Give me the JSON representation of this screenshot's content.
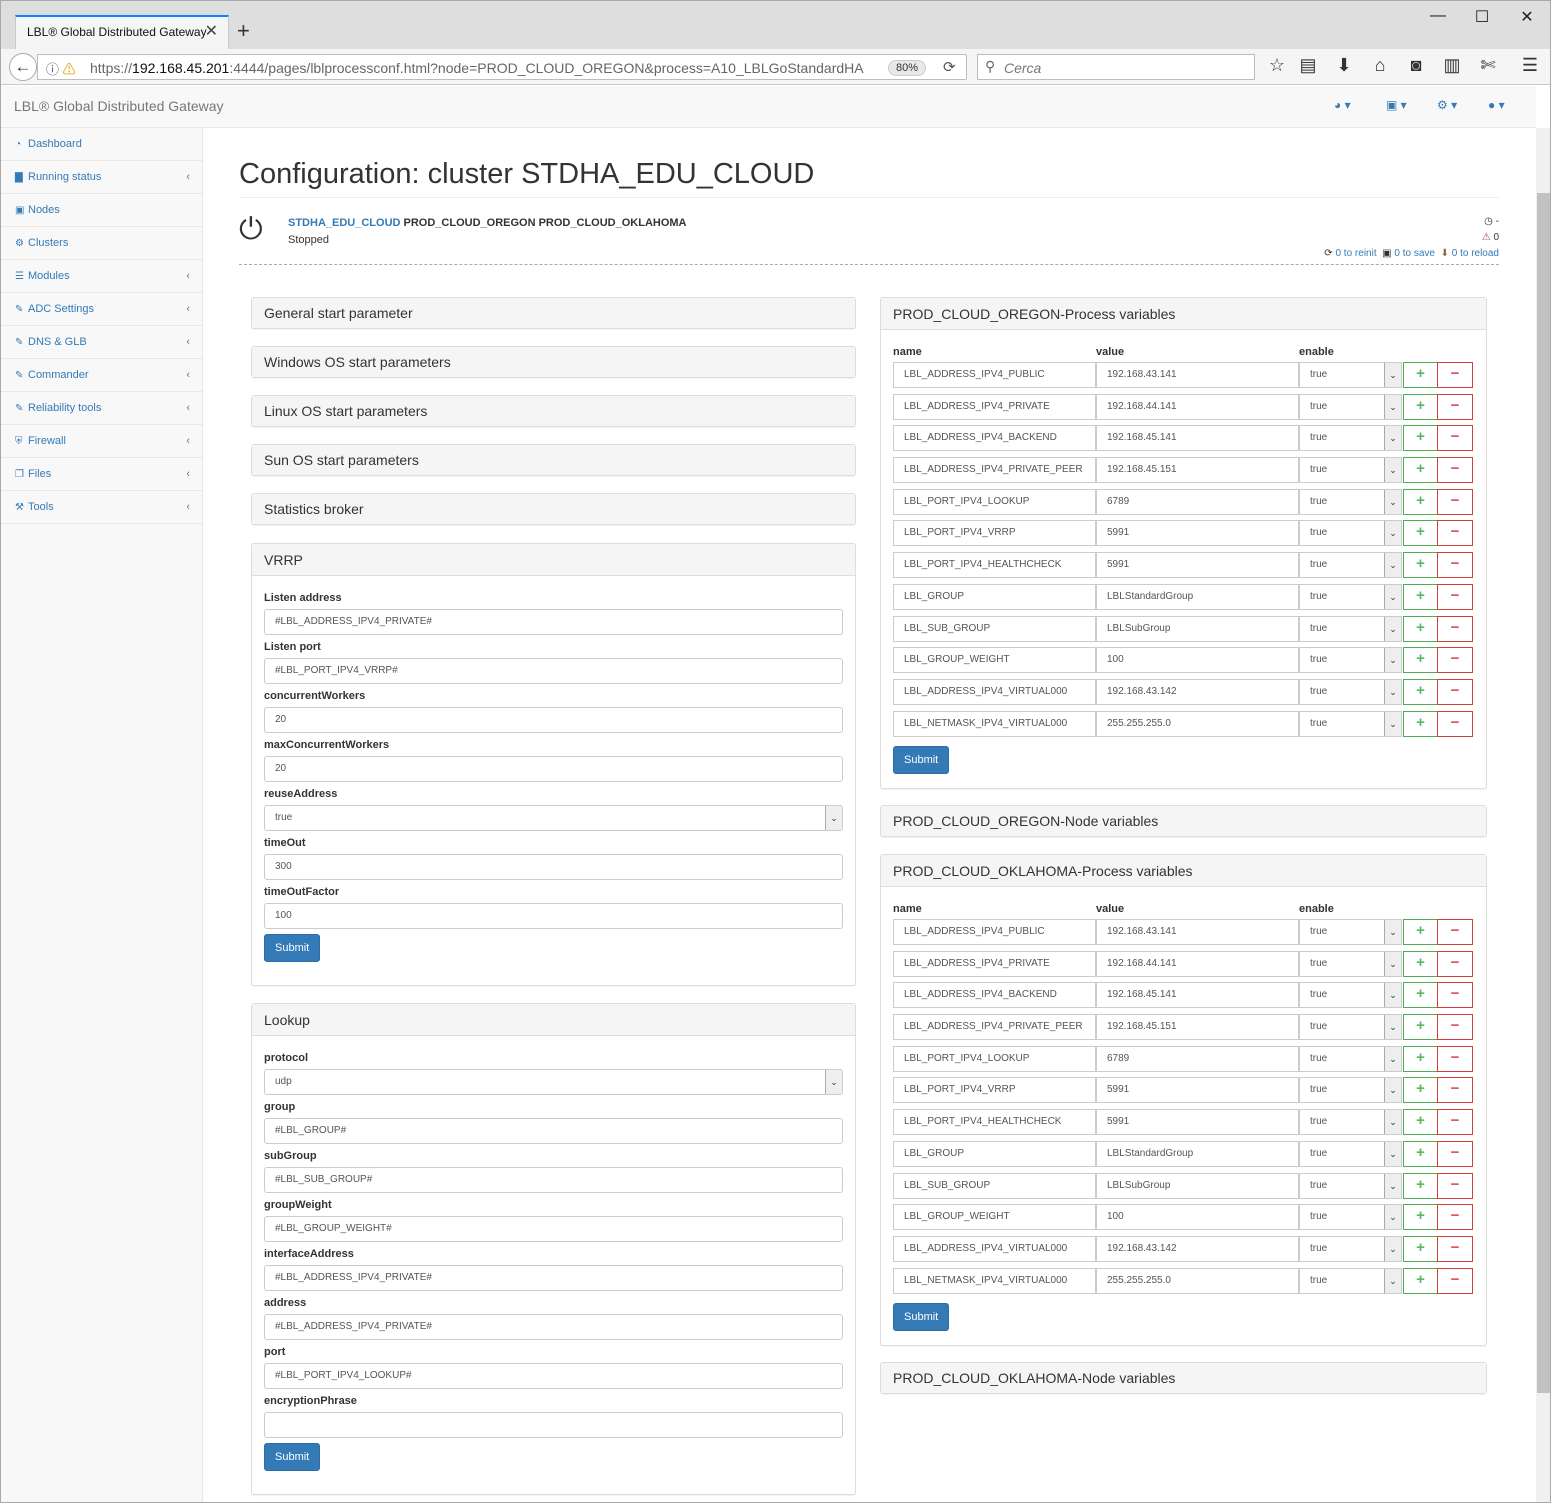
{
  "browser": {
    "tab_title": "LBL® Global Distributed Gateway",
    "url_prefix": "https://",
    "url_host": "192.168.45.201",
    "url_rest": ":4444/pages/lblprocessconf.html?node=PROD_CLOUD_OREGON&process=A10_LBLGoStandardHA",
    "zoom": "80%",
    "search_placeholder": "Cerca"
  },
  "app": {
    "brand": "LBL® Global Distributed Gateway"
  },
  "sidebar": {
    "items": [
      {
        "label": "Dashboard",
        "icon": "dashboard-icon",
        "glyph": "◔",
        "chevron": false
      },
      {
        "label": "Running status",
        "icon": "bar-chart-icon",
        "glyph": "▇",
        "chevron": true
      },
      {
        "label": "Nodes",
        "icon": "cube-icon",
        "glyph": "▣",
        "chevron": false
      },
      {
        "label": "Clusters",
        "icon": "cogs-icon",
        "glyph": "⚙",
        "chevron": false
      },
      {
        "label": "Modules",
        "icon": "list-icon",
        "glyph": "☰",
        "chevron": true
      },
      {
        "label": "ADC Settings",
        "icon": "edit-icon",
        "glyph": "✎",
        "chevron": true
      },
      {
        "label": "DNS & GLB",
        "icon": "edit-icon",
        "glyph": "✎",
        "chevron": true
      },
      {
        "label": "Commander",
        "icon": "edit-icon",
        "glyph": "✎",
        "chevron": true
      },
      {
        "label": "Reliability tools",
        "icon": "edit-icon",
        "glyph": "✎",
        "chevron": true
      },
      {
        "label": "Firewall",
        "icon": "shield-icon",
        "glyph": "⛨",
        "chevron": true
      },
      {
        "label": "Files",
        "icon": "files-icon",
        "glyph": "❐",
        "chevron": true
      },
      {
        "label": "Tools",
        "icon": "wrench-icon",
        "glyph": "⚒",
        "chevron": true
      }
    ]
  },
  "page": {
    "title": "Configuration: cluster STDHA_EDU_CLOUD",
    "cluster_link": "STDHA_EDU_CLOUD",
    "cluster_nodes": " PROD_CLOUD_OREGON PROD_CLOUD_OKLAHOMA",
    "status": "Stopped",
    "right_status_1": "-",
    "right_status_2": "0",
    "reinit": "0 to reinit",
    "save": "0 to save",
    "reload": "0 to reload"
  },
  "left_panels": {
    "general": "General start parameter",
    "windows": "Windows OS start parameters",
    "linux": "Linux OS start parameters",
    "sun": "Sun OS start parameters",
    "stats": "Statistics broker",
    "submit": "Submit"
  },
  "vrrp": {
    "title": "VRRP",
    "fields": [
      {
        "label": "Listen address",
        "value": "#LBL_ADDRESS_IPV4_PRIVATE#",
        "type": "input"
      },
      {
        "label": "Listen port",
        "value": "#LBL_PORT_IPV4_VRRP#",
        "type": "input"
      },
      {
        "label": "concurrentWorkers",
        "value": "20",
        "type": "input"
      },
      {
        "label": "maxConcurrentWorkers",
        "value": "20",
        "type": "input"
      },
      {
        "label": "reuseAddress",
        "value": "true",
        "type": "select"
      },
      {
        "label": "timeOut",
        "value": "300",
        "type": "input"
      },
      {
        "label": "timeOutFactor",
        "value": "100",
        "type": "input"
      }
    ]
  },
  "lookup": {
    "title": "Lookup",
    "fields": [
      {
        "label": "protocol",
        "value": "udp",
        "type": "select"
      },
      {
        "label": "group",
        "value": "#LBL_GROUP#",
        "type": "input"
      },
      {
        "label": "subGroup",
        "value": "#LBL_SUB_GROUP#",
        "type": "input"
      },
      {
        "label": "groupWeight",
        "value": "#LBL_GROUP_WEIGHT#",
        "type": "input"
      },
      {
        "label": "interfaceAddress",
        "value": "#LBL_ADDRESS_IPV4_PRIVATE#",
        "type": "input"
      },
      {
        "label": "address",
        "value": "#LBL_ADDRESS_IPV4_PRIVATE#",
        "type": "input"
      },
      {
        "label": "port",
        "value": "#LBL_PORT_IPV4_LOOKUP#",
        "type": "input"
      },
      {
        "label": "encryptionPhrase",
        "value": "",
        "type": "input"
      }
    ]
  },
  "right_panels": {
    "col_name": "name",
    "col_value": "value",
    "col_enable": "enable",
    "submit": "Submit",
    "oregon_process_title": "PROD_CLOUD_OREGON-Process variables",
    "oregon_node_title": "PROD_CLOUD_OREGON-Node variables",
    "oklahoma_process_title": "PROD_CLOUD_OKLAHOMA-Process variables",
    "oklahoma_node_title": "PROD_CLOUD_OKLAHOMA-Node variables"
  },
  "oregon_vars": [
    {
      "name": "LBL_ADDRESS_IPV4_PUBLIC",
      "value": "192.168.43.141",
      "enable": "true"
    },
    {
      "name": "LBL_ADDRESS_IPV4_PRIVATE",
      "value": "192.168.44.141",
      "enable": "true"
    },
    {
      "name": "LBL_ADDRESS_IPV4_BACKEND",
      "value": "192.168.45.141",
      "enable": "true"
    },
    {
      "name": "LBL_ADDRESS_IPV4_PRIVATE_PEER",
      "value": "192.168.45.151",
      "enable": "true"
    },
    {
      "name": "LBL_PORT_IPV4_LOOKUP",
      "value": "6789",
      "enable": "true"
    },
    {
      "name": "LBL_PORT_IPV4_VRRP",
      "value": "5991",
      "enable": "true"
    },
    {
      "name": "LBL_PORT_IPV4_HEALTHCHECK",
      "value": "5991",
      "enable": "true"
    },
    {
      "name": "LBL_GROUP",
      "value": "LBLStandardGroup",
      "enable": "true"
    },
    {
      "name": "LBL_SUB_GROUP",
      "value": "LBLSubGroup",
      "enable": "true"
    },
    {
      "name": "LBL_GROUP_WEIGHT",
      "value": "100",
      "enable": "true"
    },
    {
      "name": "LBL_ADDRESS_IPV4_VIRTUAL000",
      "value": "192.168.43.142",
      "enable": "true"
    },
    {
      "name": "LBL_NETMASK_IPV4_VIRTUAL000",
      "value": "255.255.255.0",
      "enable": "true"
    }
  ],
  "oklahoma_vars": [
    {
      "name": "LBL_ADDRESS_IPV4_PUBLIC",
      "value": "192.168.43.141",
      "enable": "true"
    },
    {
      "name": "LBL_ADDRESS_IPV4_PRIVATE",
      "value": "192.168.44.141",
      "enable": "true"
    },
    {
      "name": "LBL_ADDRESS_IPV4_BACKEND",
      "value": "192.168.45.141",
      "enable": "true"
    },
    {
      "name": "LBL_ADDRESS_IPV4_PRIVATE_PEER",
      "value": "192.168.45.151",
      "enable": "true"
    },
    {
      "name": "LBL_PORT_IPV4_LOOKUP",
      "value": "6789",
      "enable": "true"
    },
    {
      "name": "LBL_PORT_IPV4_VRRP",
      "value": "5991",
      "enable": "true"
    },
    {
      "name": "LBL_PORT_IPV4_HEALTHCHECK",
      "value": "5991",
      "enable": "true"
    },
    {
      "name": "LBL_GROUP",
      "value": "LBLStandardGroup",
      "enable": "true"
    },
    {
      "name": "LBL_SUB_GROUP",
      "value": "LBLSubGroup",
      "enable": "true"
    },
    {
      "name": "LBL_GROUP_WEIGHT",
      "value": "100",
      "enable": "true"
    },
    {
      "name": "LBL_ADDRESS_IPV4_VIRTUAL000",
      "value": "192.168.43.142",
      "enable": "true"
    },
    {
      "name": "LBL_NETMASK_IPV4_VIRTUAL000",
      "value": "255.255.255.0",
      "enable": "true"
    }
  ],
  "colors": {
    "accent": "#337ab7",
    "success": "#5cb85c",
    "danger": "#d9534f",
    "tab_highlight": "#0a84ff"
  }
}
